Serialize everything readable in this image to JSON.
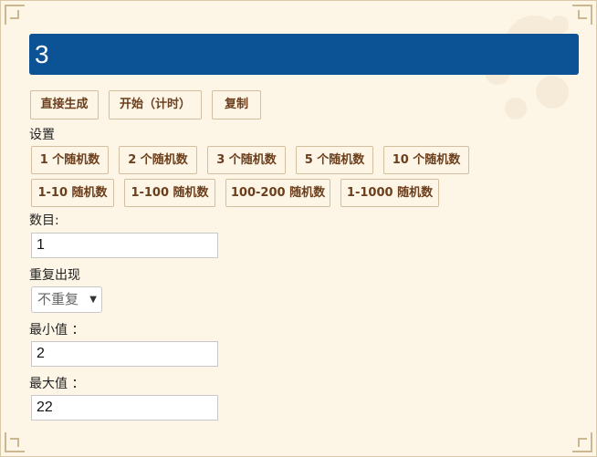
{
  "result": {
    "value": "3"
  },
  "actions": {
    "generate": "直接生成",
    "start_timed": "开始（计时）",
    "copy": "复制"
  },
  "settings": {
    "title": "设置",
    "presets_count": [
      "1 个随机数",
      "2 个随机数",
      "3 个随机数",
      "5 个随机数",
      "10 个随机数"
    ],
    "presets_range": [
      "1-10 随机数",
      "1-100 随机数",
      "100-200 随机数",
      "1-1000 随机数"
    ]
  },
  "form": {
    "count_label": "数目:",
    "count_value": "1",
    "repeat_label": "重复出现",
    "repeat_value": "不重复",
    "min_label": "最小值 ：",
    "min_value": "2",
    "max_label": "最大值 ：",
    "max_value": "22"
  },
  "colors": {
    "result_bar": "#0b5394",
    "button_text": "#6b3e1c",
    "background": "#fdf5e6"
  }
}
